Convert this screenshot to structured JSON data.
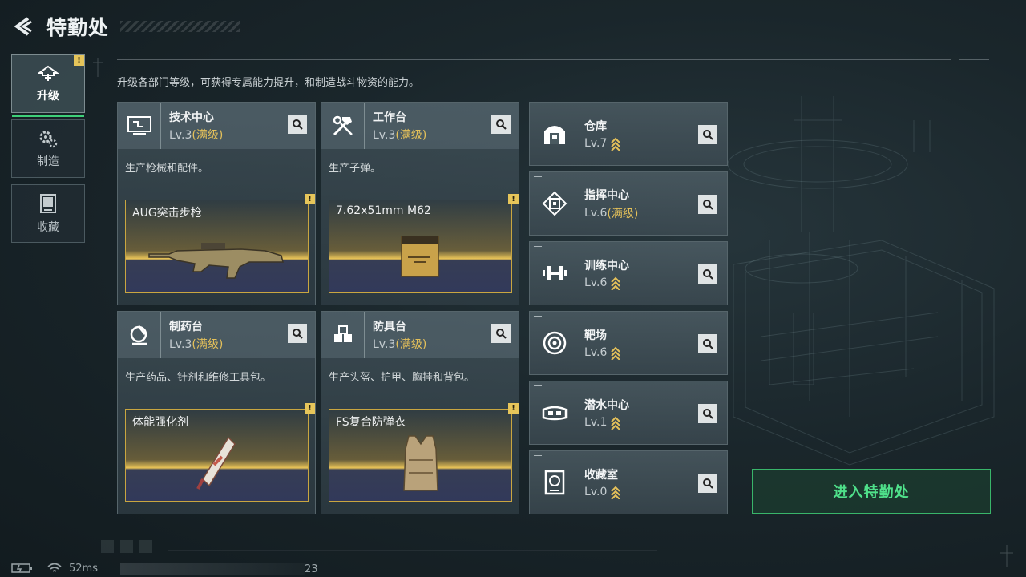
{
  "header": {
    "title": "特勤处"
  },
  "sidebar": {
    "tabs": [
      {
        "label": "升级",
        "active": true,
        "icon": "upgrade-icon",
        "warning": "!"
      },
      {
        "label": "制造",
        "active": false,
        "icon": "gears-icon"
      },
      {
        "label": "收藏",
        "active": false,
        "icon": "collection-icon"
      }
    ]
  },
  "description": "升级各部门等级，可获得专属能力提升，和制造战斗物资的能力。",
  "departments": [
    {
      "name": "技术中心",
      "level": "Lv.3",
      "max": "(满级)",
      "desc": "生产枪械和配件。",
      "product": "AUG突击步枪",
      "warning": "!",
      "icon": "tech-center-icon"
    },
    {
      "name": "工作台",
      "level": "Lv.3",
      "max": "(满级)",
      "desc": "生产子弹。",
      "product": "7.62x51mm M62",
      "warning": "!",
      "icon": "workbench-icon"
    },
    {
      "name": "制药台",
      "level": "Lv.3",
      "max": "(满级)",
      "desc": "生产药品、针剂和维修工具包。",
      "product": "体能强化剂",
      "warning": "!",
      "icon": "pharmacy-icon"
    },
    {
      "name": "防具台",
      "level": "Lv.3",
      "max": "(满级)",
      "desc": "生产头盔、护甲、胸挂和背包。",
      "product": "FS复合防弹衣",
      "warning": "!",
      "icon": "armor-bench-icon"
    }
  ],
  "facilities": [
    {
      "name": "仓库",
      "level": "Lv.7",
      "max": "",
      "icon": "warehouse-icon"
    },
    {
      "name": "指挥中心",
      "level": "Lv.6",
      "max": "(满级)",
      "icon": "command-center-icon"
    },
    {
      "name": "训练中心",
      "level": "Lv.6",
      "max": "",
      "icon": "training-center-icon"
    },
    {
      "name": "靶场",
      "level": "Lv.6",
      "max": "",
      "icon": "target-range-icon"
    },
    {
      "name": "潜水中心",
      "level": "Lv.1",
      "max": "",
      "icon": "diving-center-icon"
    },
    {
      "name": "收藏室",
      "level": "Lv.0",
      "max": "",
      "icon": "collection-room-icon"
    }
  ],
  "enter_button": "进入特勤处",
  "status": {
    "ping": "52ms",
    "count": "23"
  },
  "colors": {
    "accent_green": "#4fe08a",
    "max_gold": "#e5c15a",
    "warning_yellow": "#e6c55a"
  }
}
